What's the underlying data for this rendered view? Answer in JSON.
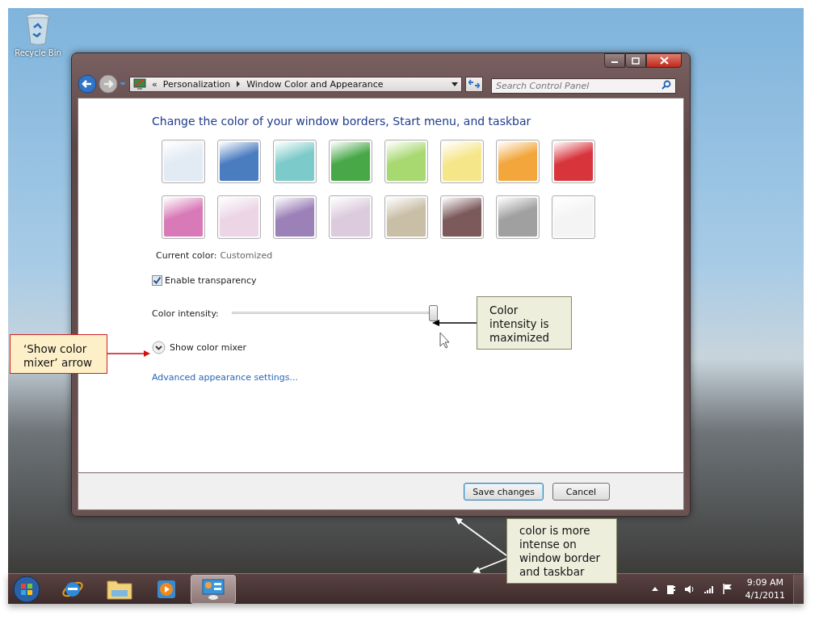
{
  "desktop": {
    "icons": [
      {
        "label": "Recycle Bin"
      }
    ]
  },
  "window": {
    "breadcrumb_overflow": "«",
    "breadcrumb": [
      "Personalization",
      "Window Color and Appearance"
    ],
    "search": {
      "placeholder": "Search Control Panel"
    },
    "heading": "Change the color of your window borders, Start menu, and taskbar",
    "swatches": [
      {
        "color": "#e2eaf4"
      },
      {
        "color": "#4a7cc0"
      },
      {
        "color": "#7ccaca"
      },
      {
        "color": "#48a848"
      },
      {
        "color": "#a8d870"
      },
      {
        "color": "#f6e68a"
      },
      {
        "color": "#f2a63c"
      },
      {
        "color": "#d8343c"
      },
      {
        "color": "#d87ab8"
      },
      {
        "color": "#ecd6e6"
      },
      {
        "color": "#9c80b8"
      },
      {
        "color": "#dccbdc"
      },
      {
        "color": "#c9bea6"
      },
      {
        "color": "#7c5a5c"
      },
      {
        "color": "#a0a0a0"
      },
      {
        "color": "#f4f4f4"
      }
    ],
    "current_color": {
      "label": "Current color:",
      "value": "Customized"
    },
    "transparency": {
      "label": "Enable transparency",
      "checked": true
    },
    "intensity": {
      "label": "Color intensity:",
      "level": 1
    },
    "mixer": {
      "label": "Show color mixer",
      "expanded": false
    },
    "link": "Advanced appearance settings...",
    "buttons": [
      {
        "label": "Save changes",
        "kind": "default"
      },
      {
        "label": "Cancel",
        "kind": "normal"
      }
    ]
  },
  "taskbar": {
    "pinned": [
      {
        "kind": "browser",
        "selected": false
      },
      {
        "kind": "folder",
        "selected": false
      },
      {
        "kind": "player",
        "selected": false
      },
      {
        "kind": "control-panel",
        "selected": true
      }
    ],
    "time": "9:09 AM",
    "date": "4/1/2011"
  },
  "callouts": [
    {
      "text": "‘Show color mixer’ arrow",
      "kind": "highlight"
    },
    {
      "text": "Color intensity is maximized",
      "kind": "note"
    },
    {
      "text": "color is more intense on window border and taskbar",
      "kind": "note"
    }
  ]
}
